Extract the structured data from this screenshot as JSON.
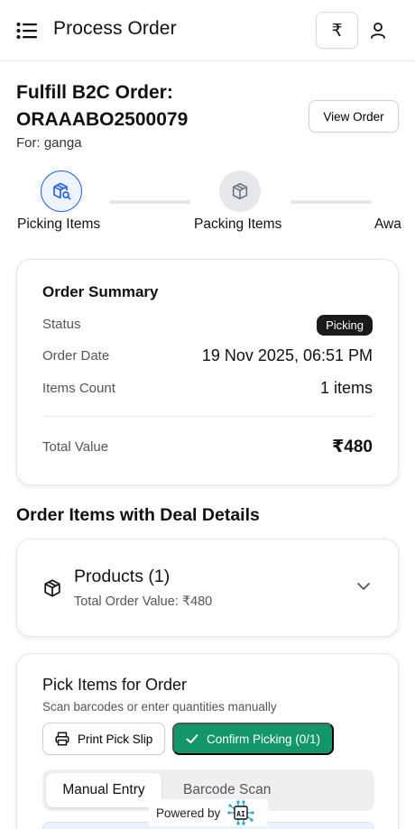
{
  "header": {
    "title": "Process Order",
    "currency_symbol": "₹"
  },
  "order": {
    "heading": "Fulfill B2C Order:",
    "id": "ORAAABO2500079",
    "for_label": "For: ganga",
    "view_button": "View Order"
  },
  "steps": [
    {
      "label": "Picking Items",
      "state": "active",
      "icon": "box-search-icon"
    },
    {
      "label": "Packing Items",
      "state": "pending",
      "icon": "box-icon"
    },
    {
      "label": "Awa",
      "state": "pending"
    }
  ],
  "summary": {
    "title": "Order Summary",
    "status_label": "Status",
    "status_value": "Picking",
    "date_label": "Order Date",
    "date_value": "19 Nov 2025, 06:51 PM",
    "count_label": "Items Count",
    "count_value": "1 items",
    "total_label": "Total Value",
    "total_value": "₹480"
  },
  "section_title": "Order Items with Deal Details",
  "products": {
    "title": "Products (1)",
    "subtitle": "Total Order Value: ₹480"
  },
  "pick": {
    "title": "Pick Items for Order",
    "subtitle": "Scan barcodes or enter quantities manually",
    "print_button": "Print Pick Slip",
    "confirm_button": "Confirm Picking (0/1)",
    "tabs": [
      "Manual Entry",
      "Barcode Scan"
    ]
  },
  "footer": {
    "powered_by": "Powered by",
    "logo_text": "AI"
  },
  "colors": {
    "accent_blue": "#2563eb",
    "confirm_green": "#14966b",
    "badge_dark": "#1a1a1a"
  }
}
